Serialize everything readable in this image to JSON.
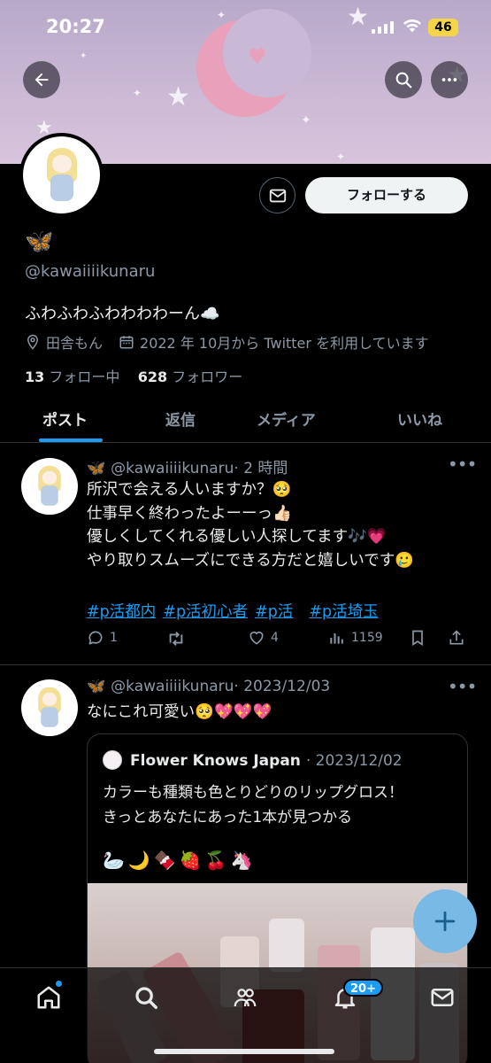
{
  "status_bar": {
    "time": "20:27",
    "battery": "46"
  },
  "profile": {
    "name_emoji": "🦋",
    "handle": "@kawaiiiikunaru",
    "bio": "ふわふわふわわわわーん☁️",
    "location": "田舎もん",
    "joined": "2022 年 10月から Twitter を利用しています",
    "following_count": "13",
    "following_label": "フォロー中",
    "followers_count": "628",
    "followers_label": "フォロワー",
    "follow_button": "フォローする"
  },
  "tabs": [
    {
      "label": "ポスト"
    },
    {
      "label": "返信"
    },
    {
      "label": "メディア"
    },
    {
      "label": "いいね"
    }
  ],
  "posts": [
    {
      "name_emoji": "🦋",
      "handle": "@kawaiiiikunaru",
      "time": "· 2 時間",
      "text": "所沢で会える人いますか？🥺\n仕事早く終わったよーーっ👍🏻\n優しくしてくれる優しい人探してます🎶💗\nやり取りスムーズにできる方だと嬉しいです🥲",
      "tags": [
        "#p活都内",
        "#p活初心者",
        "#p活",
        "#p活埼玉"
      ],
      "replies": "1",
      "retweets": "",
      "likes": "4",
      "views": "1159"
    },
    {
      "name_emoji": "🦋",
      "handle": "@kawaiiiikunaru",
      "time": "· 2023/12/03",
      "text": "なにこれ可愛い🥺💖💖💖",
      "quote": {
        "name": "Flower Knows Japan",
        "date": "· 2023/12/02",
        "text": "カラーも種類も色とりどりのリップグロス！\nきっとあなたにあった1本が見つかる",
        "emoji": "🦢🌙🍫🍓🍒🦄"
      }
    }
  ],
  "bottom_nav": {
    "notifications_badge": "20+"
  },
  "colors": {
    "accent": "#1d9bf0",
    "background": "#000000",
    "muted": "#8b98a5"
  }
}
